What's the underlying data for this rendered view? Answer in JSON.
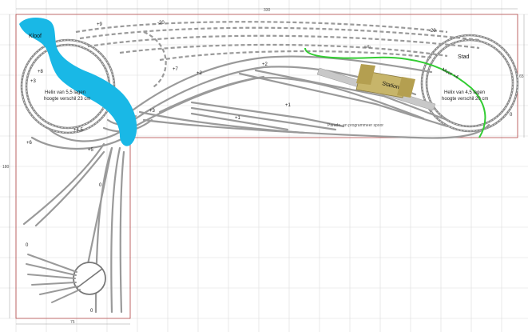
{
  "labels": {
    "kloof": "Kloof",
    "helix_left_line1": "Helix van 5,5 lagen",
    "helix_left_line2": "hoogte verschil 23 cm",
    "helix_right_line1": "Helix van 4,5 lagen",
    "helix_right_line2": "hoogte verschil 20 cm",
    "stad": "Stad",
    "station": "Station",
    "muur": "Muur +4",
    "parade": "Parade- en programmeer spoor",
    "wtb": "wtb"
  },
  "heights": [
    "+9",
    "-20",
    "-20",
    "+8",
    "+3",
    "+7",
    "+2",
    "+2",
    "+1",
    "+1",
    "+3",
    "+4,5",
    "+6",
    "+5",
    "0",
    "0",
    "0",
    "0"
  ],
  "dimensions": {
    "top": "330",
    "left": "180",
    "right": "65",
    "bottom": "75"
  },
  "colors": {
    "water": "#19b8e6",
    "wall": "#33cc33",
    "station": "#c7b56a",
    "outline": "#b04040"
  }
}
